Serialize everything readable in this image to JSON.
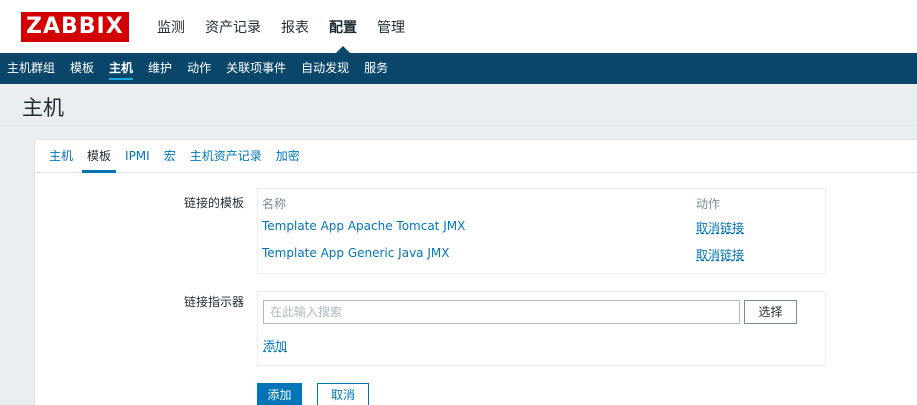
{
  "brand": {
    "logo_text": "ZABBIX",
    "logo_color": "#d40000",
    "nav_color": "#0a466a",
    "link_color": "#0275b8"
  },
  "main_menu": {
    "items": [
      {
        "label": "监测"
      },
      {
        "label": "资产记录"
      },
      {
        "label": "报表"
      },
      {
        "label": "配置",
        "active": true
      },
      {
        "label": "管理"
      }
    ]
  },
  "sub_menu": {
    "items": [
      {
        "label": "主机群组"
      },
      {
        "label": "模板"
      },
      {
        "label": "主机",
        "active": true
      },
      {
        "label": "维护"
      },
      {
        "label": "动作"
      },
      {
        "label": "关联项事件"
      },
      {
        "label": "自动发现"
      },
      {
        "label": "服务"
      }
    ]
  },
  "page": {
    "title": "主机"
  },
  "tabs": [
    {
      "label": "主机"
    },
    {
      "label": "模板",
      "active": true
    },
    {
      "label": "IPMI"
    },
    {
      "label": "宏"
    },
    {
      "label": "主机资产记录"
    },
    {
      "label": "加密"
    }
  ],
  "linked_templates": {
    "label": "链接的模板",
    "col_name": "名称",
    "col_action": "动作",
    "rows": [
      {
        "name": "Template App Apache Tomcat JMX",
        "action": "取消链接"
      },
      {
        "name": "Template App Generic Java JMX",
        "action": "取消链接"
      }
    ]
  },
  "link_new": {
    "label": "链接指示器",
    "search_placeholder": "在此输入搜索",
    "select_label": "选择",
    "add_link": "添加"
  },
  "buttons": {
    "add": "添加",
    "cancel": "取消"
  }
}
